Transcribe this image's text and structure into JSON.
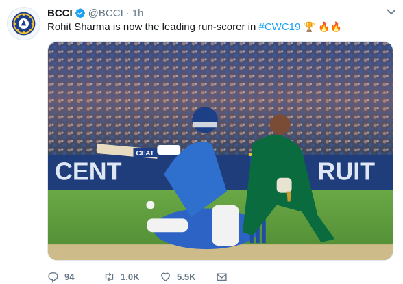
{
  "tweet": {
    "author_name": "BCCI",
    "handle": "@BCCI",
    "separator": "·",
    "time": "1h",
    "text_before": "Rohit Sharma is now the leading run-scorer in ",
    "hashtag": "#CWC19",
    "emojis": "🏆 🔥🔥",
    "media": {
      "banner_text": "CENT",
      "banner_text_right": "RUIT",
      "bat_sponsor": "CEAT"
    }
  },
  "actions": {
    "reply_count": "94",
    "retweet_count": "1.0K",
    "like_count": "5.5K"
  },
  "colors": {
    "link": "#1da1f2",
    "muted": "#657786",
    "india_blue": "#2f6fce",
    "bangladesh_green": "#0a6b3e",
    "pitch_green": "#5c9a3b"
  },
  "icons": {
    "avatar": "bcci-logo-icon",
    "verified": "verified-badge-icon",
    "caret": "chevron-down-icon",
    "reply": "reply-icon",
    "retweet": "retweet-icon",
    "like": "heart-icon",
    "dm": "envelope-icon"
  }
}
